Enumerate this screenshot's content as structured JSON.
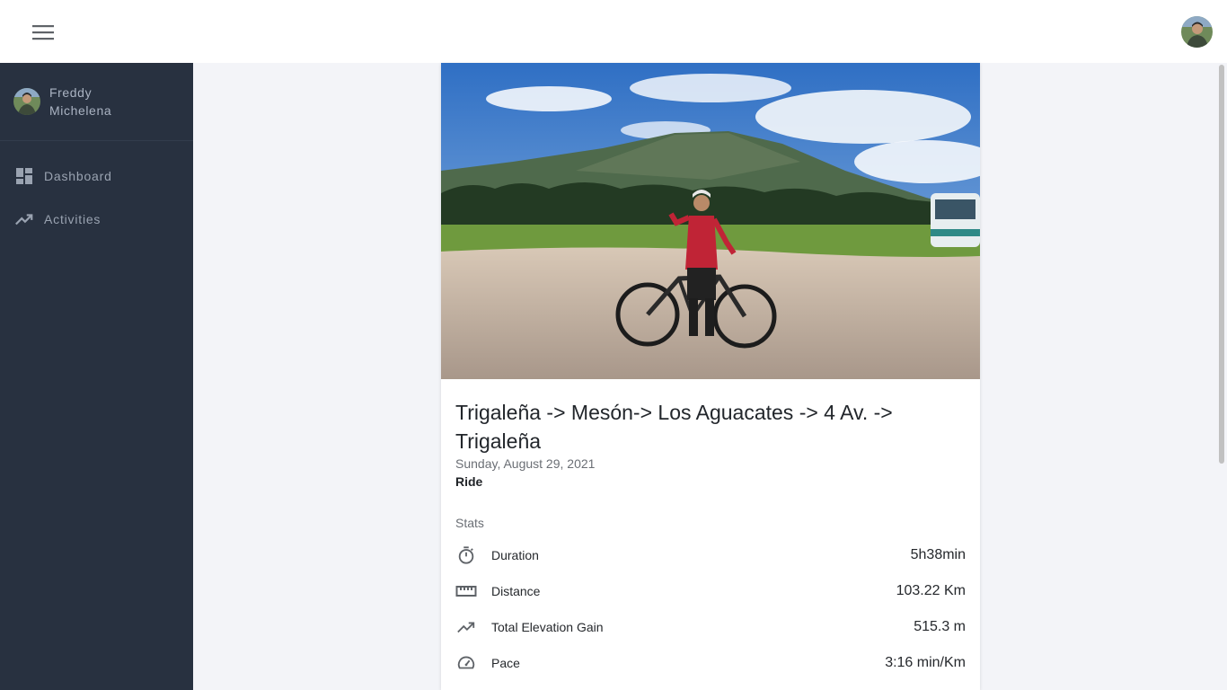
{
  "header": {
    "menu_icon": "hamburger-menu-icon",
    "avatar_icon": "user-avatar"
  },
  "sidebar": {
    "user_name": "Freddy Michelena",
    "items": [
      {
        "label": "Dashboard",
        "icon": "dashboard-icon"
      },
      {
        "label": "Activities",
        "icon": "trending-up-icon"
      }
    ]
  },
  "activity": {
    "photo": "cyclist-with-bike-mountain-photo",
    "title": "Trigaleña -> Mesón-> Los Aguacates -> 4 Av. -> Trigaleña",
    "date": "Sunday, August 29, 2021",
    "type": "Ride",
    "stats_heading": "Stats",
    "stats": [
      {
        "label": "Duration",
        "value": "5h38min",
        "icon": "timer-icon"
      },
      {
        "label": "Distance",
        "value": "103.22 Km",
        "icon": "ruler-icon"
      },
      {
        "label": "Total Elevation Gain",
        "value": "515.3 m",
        "icon": "trending-up-icon"
      },
      {
        "label": "Pace",
        "value": "3:16 min/Km",
        "icon": "speedometer-icon"
      }
    ]
  },
  "colors": {
    "sidebar_bg": "#283140",
    "page_bg": "#f3f4f8",
    "sidebar_text": "#9aa3b1"
  }
}
